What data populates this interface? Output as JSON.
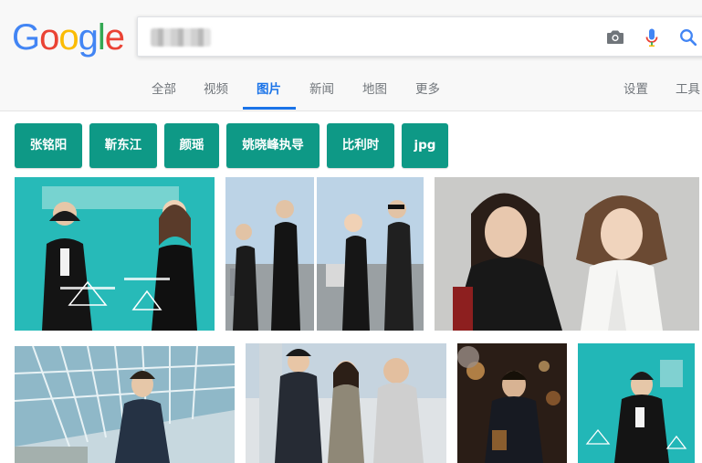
{
  "logo": {
    "letters": [
      "G",
      "o",
      "o",
      "g",
      "l",
      "e"
    ],
    "colors": [
      "#4285f4",
      "#ea4335",
      "#fbbc05",
      "#4285f4",
      "#34a853",
      "#ea4335"
    ]
  },
  "search": {
    "value": "",
    "icons": {
      "camera": "camera-icon",
      "mic": "mic-icon",
      "search": "search-icon"
    }
  },
  "tabs": [
    "全部",
    "视频",
    "图片",
    "新闻",
    "地图",
    "更多"
  ],
  "active_tab": "图片",
  "settings_label": "设置",
  "tools_label": "工具",
  "chips": [
    "张铭阳",
    "靳东江",
    "颜瑶",
    "姚晓峰执导",
    "比利时",
    "jpg"
  ],
  "colors": {
    "accent": "#1a73e8",
    "chip": "#0e9986",
    "teal_poster": "#1fb4b4"
  },
  "images": [
    {
      "name": "teal-poster-duo"
    },
    {
      "name": "airport-group-photo"
    },
    {
      "name": "actors-portrait-leather"
    },
    {
      "name": "glass-building-actor"
    },
    {
      "name": "three-people-event"
    },
    {
      "name": "dark-bar-poster"
    },
    {
      "name": "teal-poster-single"
    }
  ]
}
